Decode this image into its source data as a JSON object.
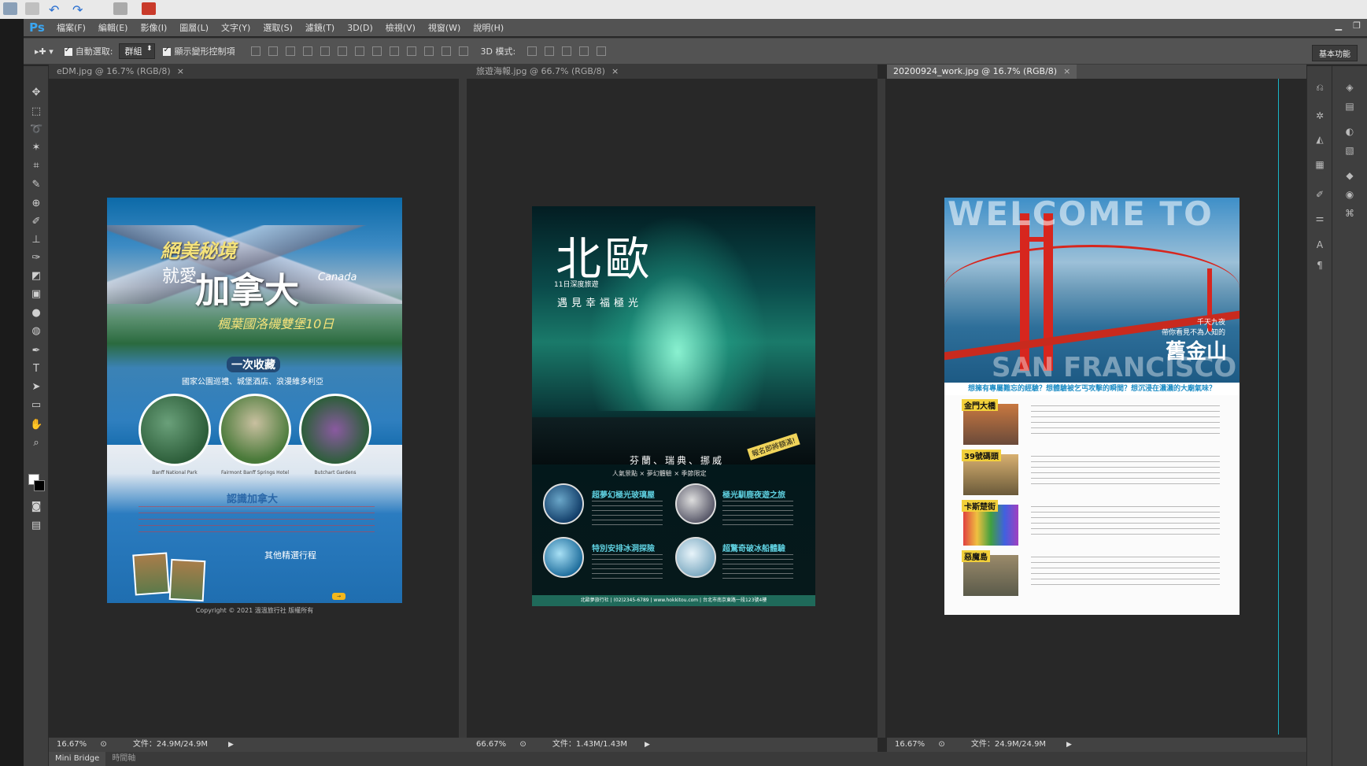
{
  "app": {
    "logo": "Ps"
  },
  "menu": [
    "檔案(F)",
    "編輯(E)",
    "影像(I)",
    "圖層(L)",
    "文字(Y)",
    "選取(S)",
    "濾鏡(T)",
    "3D(D)",
    "檢視(V)",
    "視窗(W)",
    "說明(H)"
  ],
  "options": {
    "auto_select_label": "自動選取:",
    "auto_select_value": "群組",
    "show_transform_label": "顯示變形控制項",
    "mode_3d_label": "3D 模式:",
    "workspace": "基本功能"
  },
  "documents": [
    {
      "tab": "eDM.jpg @ 16.7% (RGB/8)",
      "zoom": "16.67%",
      "file": "文件：24.9M/24.9M",
      "active": false
    },
    {
      "tab": "旅遊海報.jpg @ 66.7% (RGB/8)",
      "zoom": "66.67%",
      "file": "文件：1.43M/1.43M",
      "active": false
    },
    {
      "tab": "20200924_work.jpg @ 16.7% (RGB/8)",
      "zoom": "16.67%",
      "file": "文件：24.9M/24.9M",
      "active": true
    }
  ],
  "bottom_tabs": [
    "Mini Bridge",
    "時間軸"
  ],
  "poster1": {
    "title1": "絕美秘境",
    "title2": "就愛",
    "title3": "加拿大",
    "title3_en": "Canada",
    "subtitle": "楓葉國洛磯雙堡10日",
    "badge": "一次收藏",
    "tagline": "國家公園巡禮、城堡酒店、浪漫維多利亞",
    "captions": [
      "Banff National Park",
      "Fairmont Banff Springs Hotel",
      "Butchart Gardens"
    ],
    "section": "認識加拿大",
    "other": "其他精選行程",
    "copyright": "Copyright © 2021 溫溫旅行社 版權所有"
  },
  "poster2": {
    "heading": "北歐",
    "sub1": "11日深度旅遊",
    "sub2": "遇見幸福極光",
    "countries": "芬蘭、瑞典、挪威",
    "features_line": "人氣景點 × 夢幻體驗 × 季節限定",
    "tag": "報名即將額滿!",
    "features": [
      "超夢幻極光玻璃屋",
      "極光馴鹿夜遊之旅",
      "特別安排冰洞探險",
      "超驚奇破冰船體驗"
    ],
    "footer": "北歐夢旅行社  |  (02)2345-6789  |  www.hokkitou.com  |  台北市南京東路一段123號4樓"
  },
  "poster3": {
    "welcome": "WELCOME TO",
    "city_en": "SAN FRANCISCO",
    "sub1": "千天九夜",
    "sub2": "帶你看見不為人知的",
    "city": "舊金山",
    "band": "想擁有專屬難忘的經驗？想體驗被乞丐攻擊的瞬間？想沉浸在濃濃的大廟氣味？",
    "items": [
      "金門大橋",
      "39號碼頭",
      "卡斯楚街",
      "惡魔島"
    ]
  }
}
